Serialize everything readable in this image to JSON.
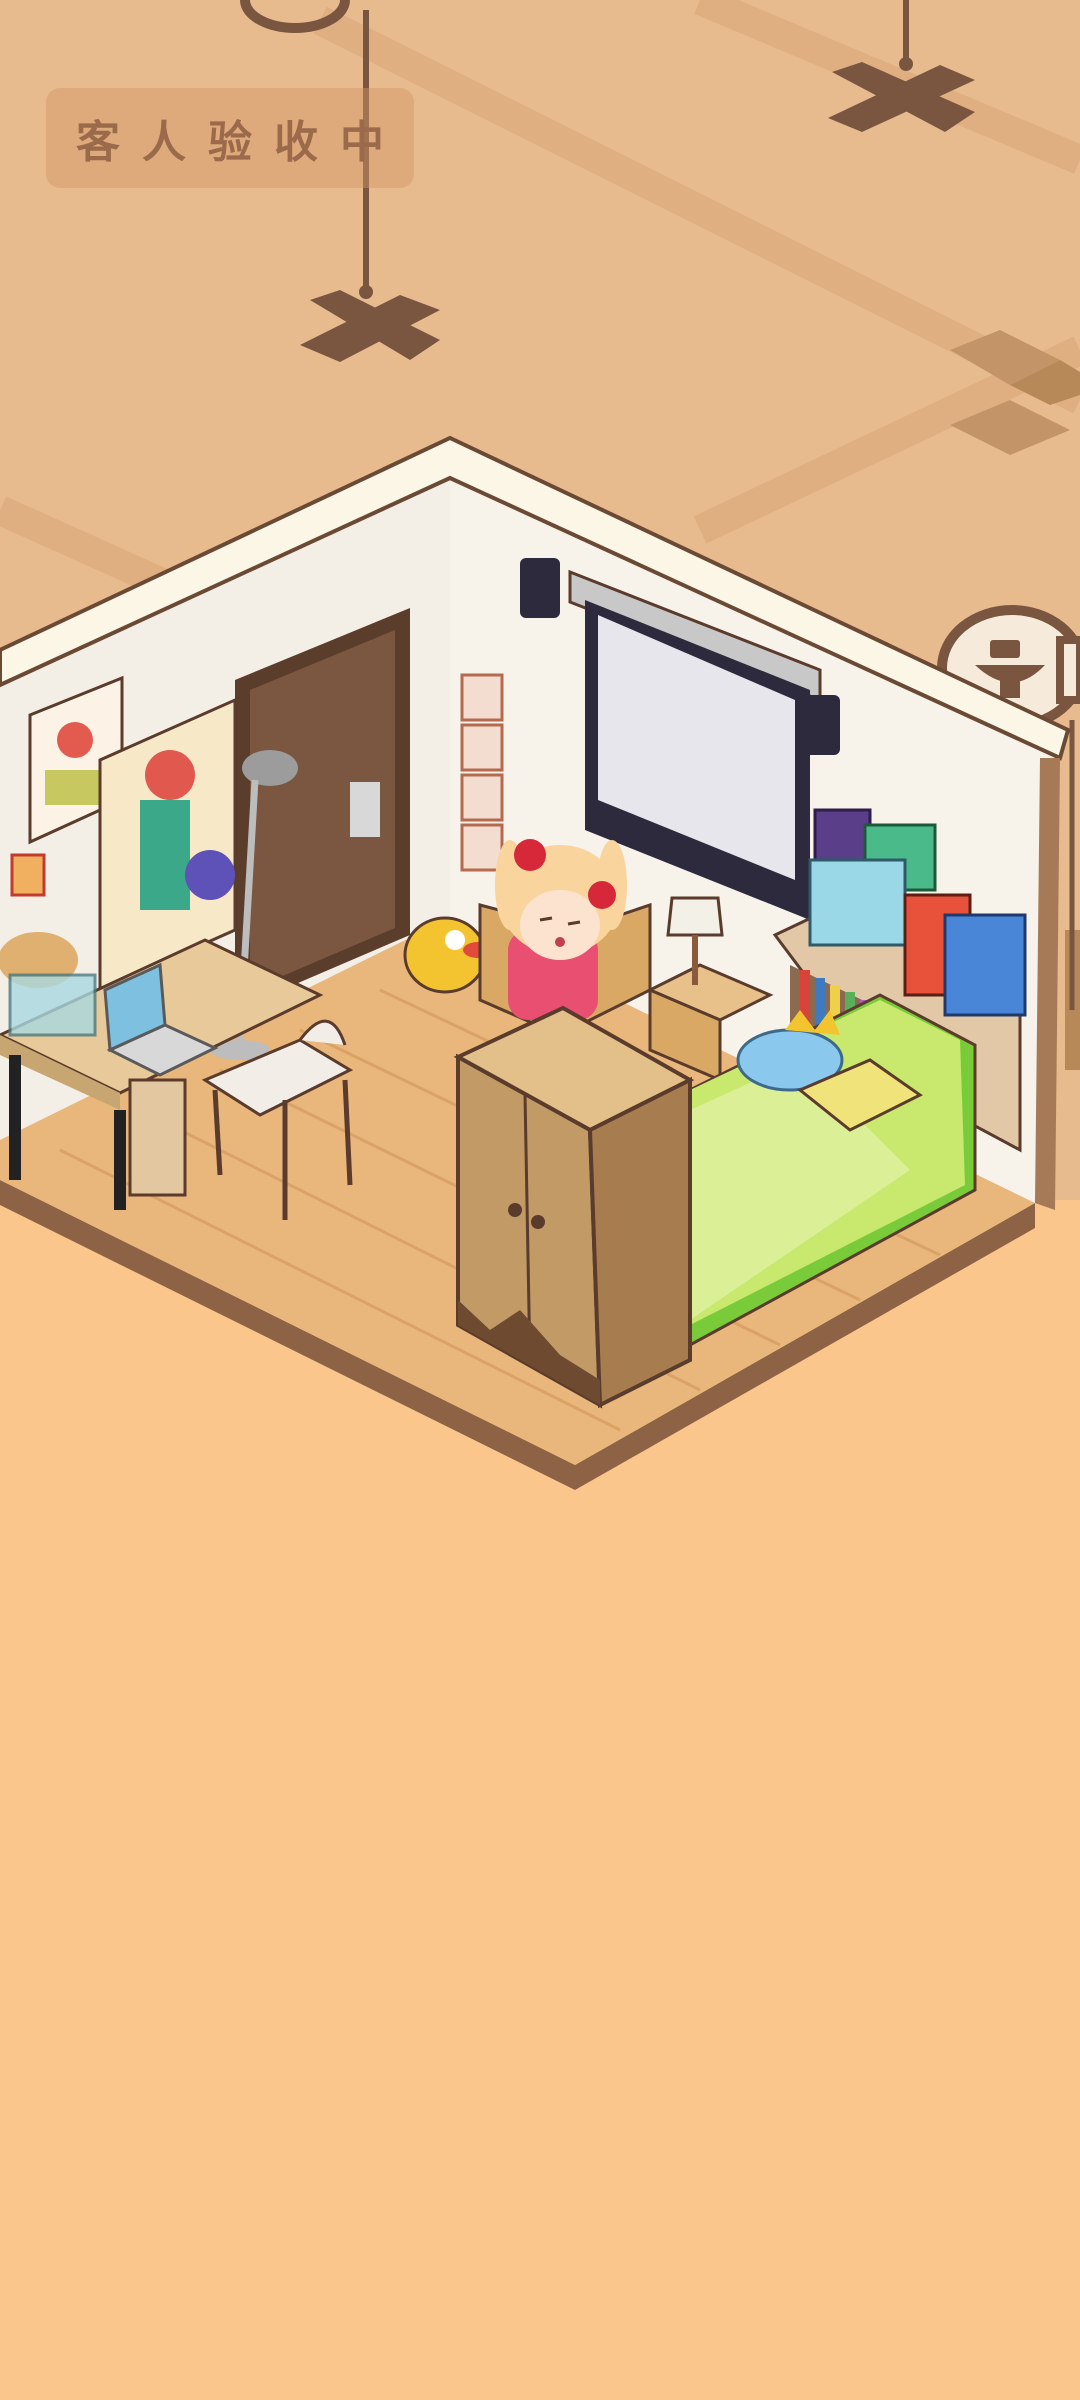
{
  "status": {
    "label": "客人验收中"
  },
  "colors": {
    "background_top": "#E8BB8E",
    "background_bottom": "#FBC68C",
    "marker": "#7A5640",
    "badge_text": "#9A6A4A",
    "room_floor": "#E9B77B",
    "room_wall": "#F4EFE6",
    "bed_blanket": "#C9E86E",
    "bed_frame_green": "#7ACB3A"
  },
  "icons": {
    "placement_marker": "x-cross-marker-icon",
    "toilet": "toilet-icon",
    "character": "girl-character"
  }
}
